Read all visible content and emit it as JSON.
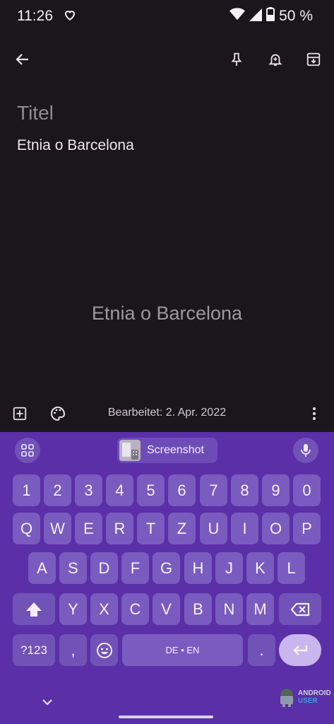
{
  "status_bar": {
    "time": "11:26",
    "battery": "50 %",
    "icons": [
      "heart-icon",
      "wifi-icon",
      "signal-icon",
      "battery-icon"
    ]
  },
  "toolbar": {
    "icons": [
      "back-arrow-icon",
      "pin-icon",
      "reminder-bell-icon",
      "archive-icon"
    ]
  },
  "note": {
    "title_placeholder": "Titel",
    "body": "Etnia o Barcelona",
    "watermark": "Etnia o Barcelona"
  },
  "bottom_bar": {
    "edited": "Bearbeitet: 2. Apr. 2022",
    "icons": [
      "add-box-icon",
      "palette-icon",
      "more-vert-icon"
    ]
  },
  "keyboard": {
    "suggestion": "Screenshot",
    "number_row": [
      "1",
      "2",
      "3",
      "4",
      "5",
      "6",
      "7",
      "8",
      "9",
      "0"
    ],
    "row1": [
      "Q",
      "W",
      "E",
      "R",
      "T",
      "Z",
      "U",
      "I",
      "O",
      "P"
    ],
    "row2": [
      "A",
      "S",
      "D",
      "F",
      "G",
      "H",
      "J",
      "K",
      "L"
    ],
    "row3": [
      "Y",
      "X",
      "C",
      "V",
      "B",
      "N",
      "M"
    ],
    "symbols_key": "?123",
    "comma_key": ",",
    "space_label": "DE • EN",
    "period_key": ".",
    "colors": {
      "background": "#5a2fa8",
      "key": "#7a5bbf",
      "enter": "#c9b6ee"
    }
  },
  "logo": {
    "line1": "ANDROID",
    "line2": "USER"
  }
}
